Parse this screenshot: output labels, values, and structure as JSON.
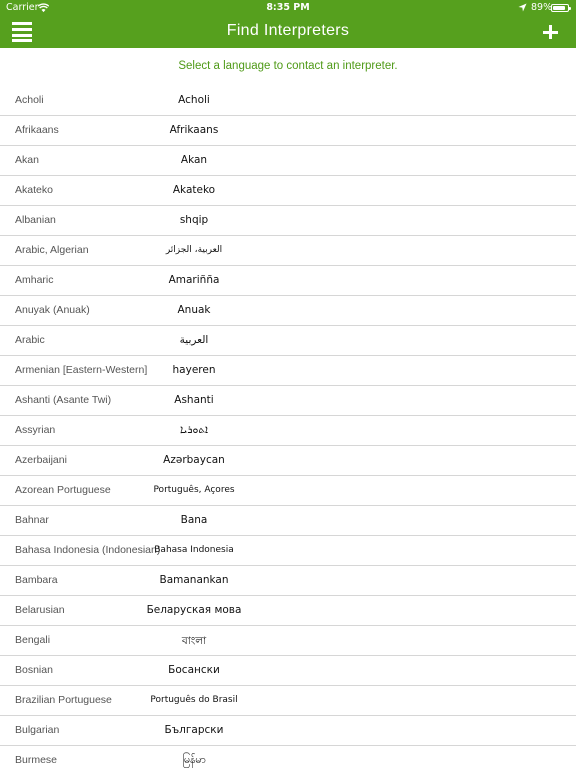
{
  "status_bar": {
    "carrier": "Carrier",
    "time": "8:35 PM",
    "battery_pct": "89%",
    "battery_level": 0.89
  },
  "navbar": {
    "title": "Find Interpreters"
  },
  "instruction": "Select a language to contact an interpreter.",
  "languages": [
    {
      "english": "Acholi",
      "native": "Acholi"
    },
    {
      "english": "Afrikaans",
      "native": "Afrikaans"
    },
    {
      "english": "Akan",
      "native": "Akan"
    },
    {
      "english": "Akateko",
      "native": "Akateko"
    },
    {
      "english": "Albanian",
      "native": "shqip"
    },
    {
      "english": "Arabic, Algerian",
      "native": "العربية، الجزائر"
    },
    {
      "english": "Amharic",
      "native": "Amariñña"
    },
    {
      "english": "Anuyak (Anuak)",
      "native": "Anuak"
    },
    {
      "english": "Arabic",
      "native": "العربية"
    },
    {
      "english": "Armenian [Eastern-Western]",
      "native": "hayeren"
    },
    {
      "english": "Ashanti (Asante Twi)",
      "native": "Ashanti"
    },
    {
      "english": "Assyrian",
      "native": "ܐܬܘܪܝܐ"
    },
    {
      "english": "Azerbaijani",
      "native": "Azərbaycan"
    },
    {
      "english": "Azorean Portuguese",
      "native": "Português, Açores"
    },
    {
      "english": "Bahnar",
      "native": "Bana"
    },
    {
      "english": "Bahasa Indonesia (Indonesian)",
      "native": "Bahasa Indonesia"
    },
    {
      "english": "Bambara",
      "native": "Bamanankan"
    },
    {
      "english": "Belarusian",
      "native": "Беларуская мова"
    },
    {
      "english": "Bengali",
      "native": "বাংলা"
    },
    {
      "english": "Bosnian",
      "native": "Босански"
    },
    {
      "english": "Brazilian Portuguese",
      "native": "Português do Brasil"
    },
    {
      "english": "Bulgarian",
      "native": "Български"
    },
    {
      "english": "Burmese",
      "native": "မြန်မာ"
    }
  ]
}
